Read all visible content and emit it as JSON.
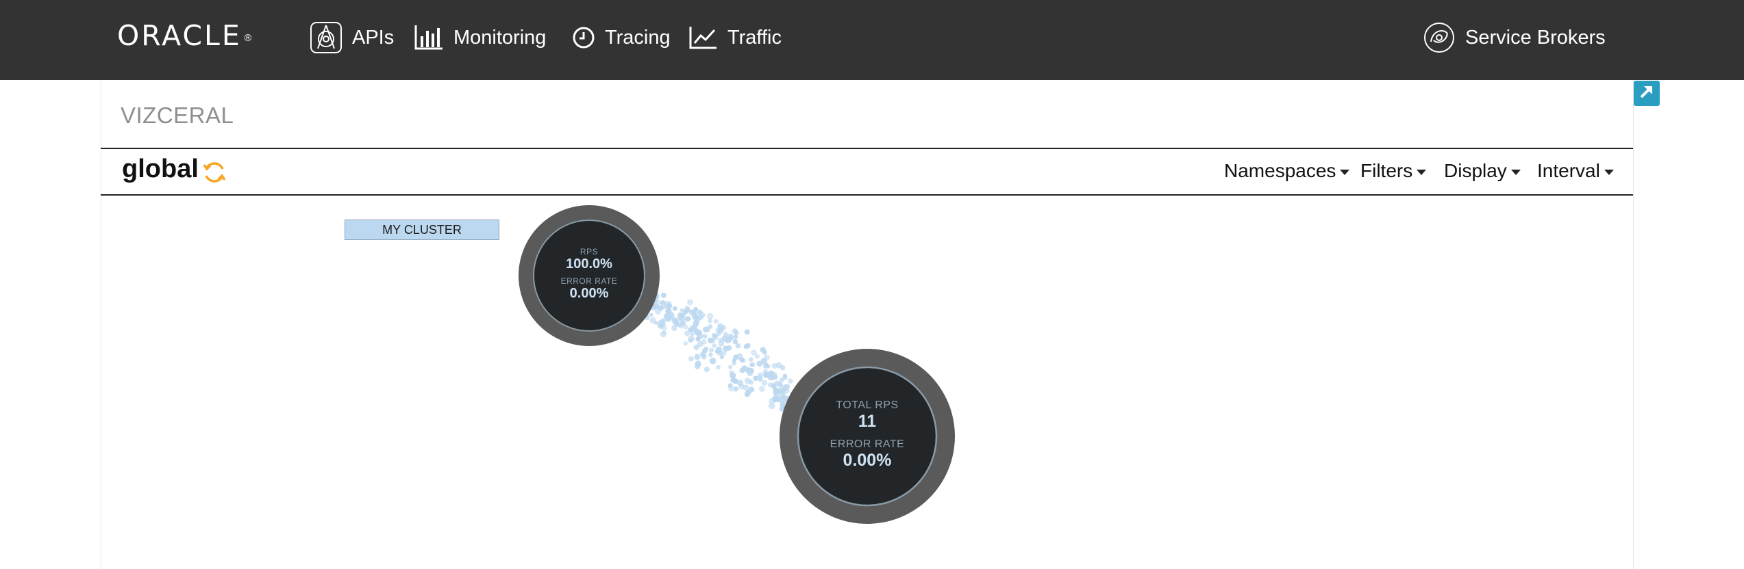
{
  "header": {
    "logo": "ORACLE",
    "nav": [
      {
        "label": "APIs",
        "icon": "api-icon"
      },
      {
        "label": "Monitoring",
        "icon": "bar-chart-icon"
      },
      {
        "label": "Tracing",
        "icon": "clock-icon"
      },
      {
        "label": "Traffic",
        "icon": "line-chart-icon"
      }
    ],
    "right_nav": {
      "label": "Service Brokers",
      "icon": "service-broker-icon"
    }
  },
  "page": {
    "section_title": "VIZCERAL",
    "view_title": "global",
    "menus": [
      "Namespaces",
      "Filters",
      "Display",
      "Interval"
    ]
  },
  "graph": {
    "cluster_label": "MY CLUSTER",
    "small_node": {
      "rps_label": "RPS",
      "rps_value": "100.0%",
      "error_label": "ERROR RATE",
      "error_value": "0.00%"
    },
    "big_node": {
      "rps_label": "TOTAL RPS",
      "rps_value": "11",
      "error_label": "ERROR RATE",
      "error_value": "0.00%"
    }
  },
  "colors": {
    "topbar": "#333333",
    "accent": "#2a9ec1",
    "refresh": "#f5a623",
    "particles": "#bcd8f0"
  }
}
